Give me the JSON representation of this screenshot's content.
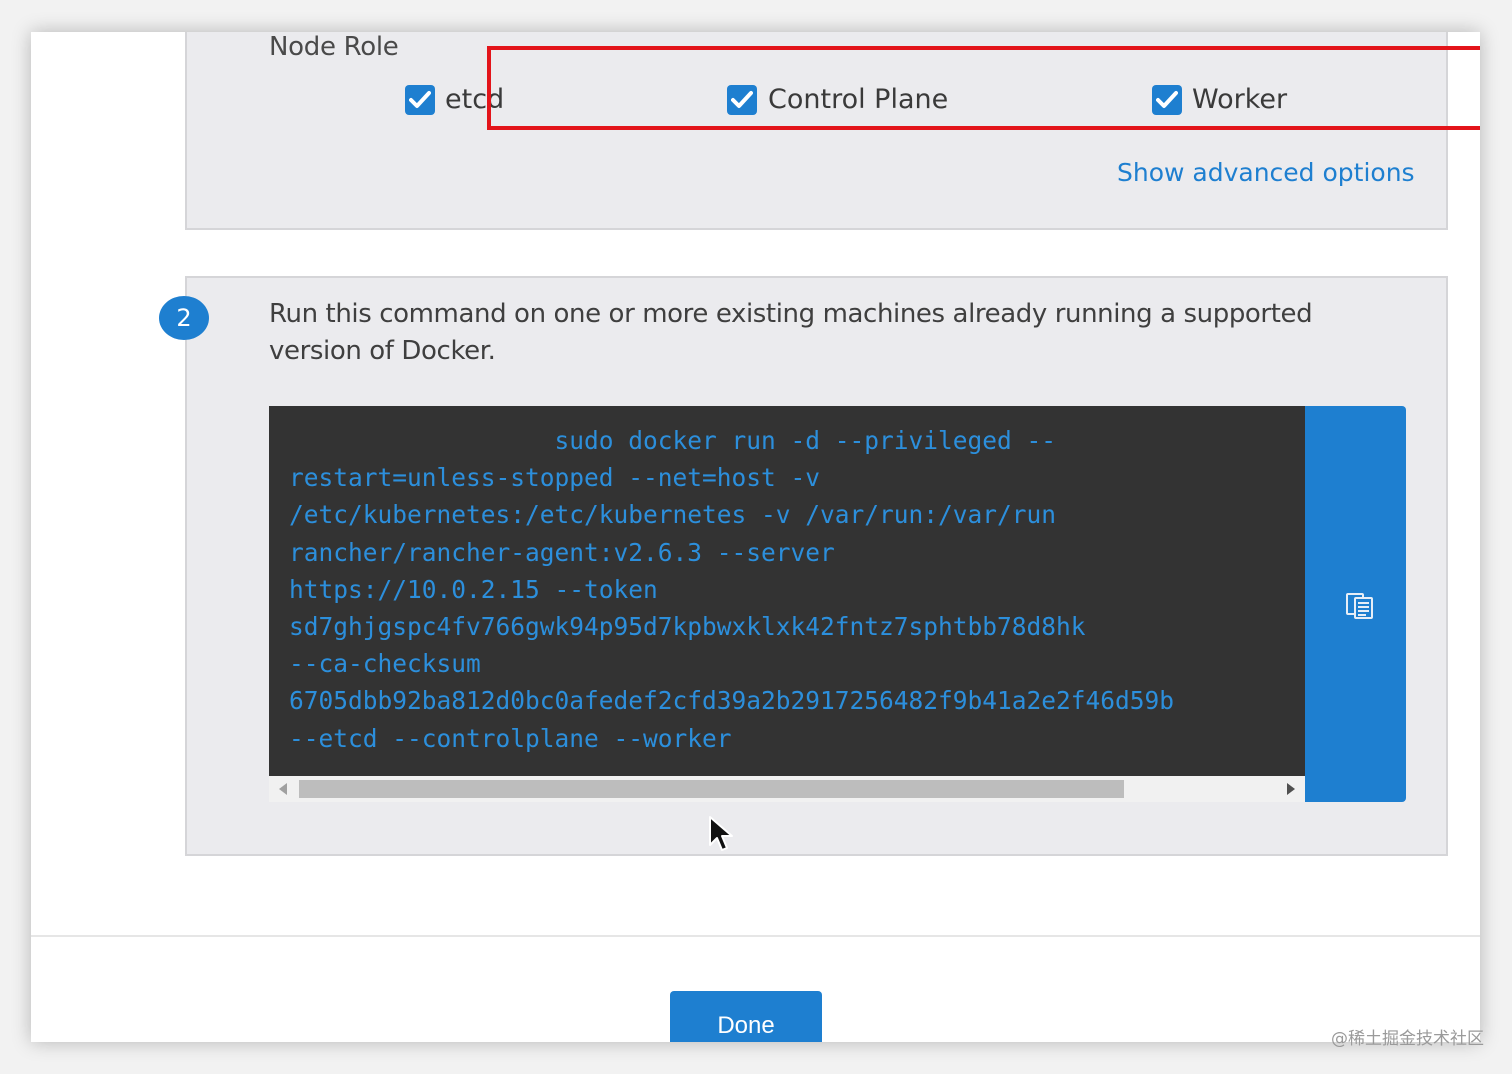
{
  "node_role": {
    "label": "Node Role",
    "roles": [
      {
        "label": "etcd",
        "checked": true
      },
      {
        "label": "Control Plane",
        "checked": true
      },
      {
        "label": "Worker",
        "checked": true
      }
    ],
    "advanced_link": "Show advanced options"
  },
  "step2": {
    "number": "2",
    "instruction": "Run this command on one or more existing machines already running a supported version of Docker.",
    "command": "                  sudo docker run -d --privileged --\nrestart=unless-stopped --net=host -v\n/etc/kubernetes:/etc/kubernetes -v /var/run:/var/run\nrancher/rancher-agent:v2.6.3 --server\nhttps://10.0.2.15 --token\nsd7ghjgspc4fv766gwk94p95d7kpbwxklxk42fntz7sphtbb78d8hk\n--ca-checksum\n6705dbb92ba812d0bc0afedef2cfd39a2b2917256482f9b41a2e2f46d59b\n--etcd --controlplane --worker",
    "copy_icon": "clipboard-icon"
  },
  "footer": {
    "done_label": "Done"
  },
  "watermark": "@稀土掘金技术社区",
  "colors": {
    "accent": "#1e7fd0",
    "highlight": "#e3141a",
    "code_bg": "#333333"
  }
}
